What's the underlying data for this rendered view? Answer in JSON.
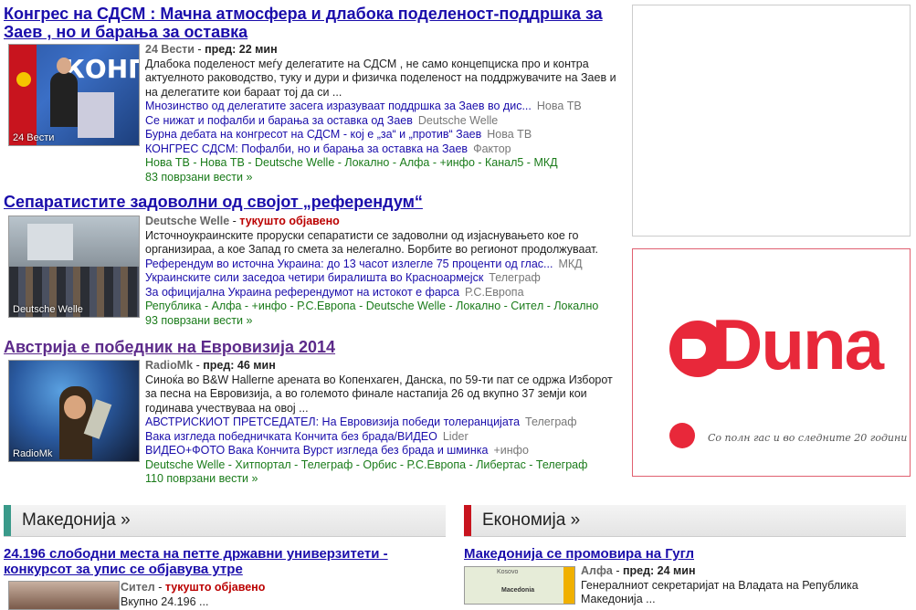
{
  "stories": [
    {
      "title": "Конгрес на СДСМ : Мачна атмосфера и длабока поделеност-поддршка за Заев , но и барања за оставка",
      "thumb_caption": "24 Вести",
      "source": "24 Вести",
      "time": "пред: 22 мин",
      "snippet": "Длабока поделеност меѓу делегатите на СДСМ , не само концепциска про и контра актуелното раководство, туку и дури и физичка поделеност на поддржувачите на Заев и на делегатите кои бараат тој да си ...",
      "related": [
        {
          "text": "Мнозинство од делегатите засега изразуваат поддршка за Заев во дис...",
          "source": "Нова ТВ"
        },
        {
          "text": "Се нижат и пофалби и барања за оставка од Заев",
          "source": "Deutsche Welle"
        },
        {
          "text": "Бурна дебата на конгресот на СДСМ - кој е „за“ и „против“ Заев",
          "source": "Нова ТВ"
        },
        {
          "text": "КОНГРЕС СДСМ: Пофалби, но и барања за оставка на Заев",
          "source": "Фактор"
        }
      ],
      "source_list": "Нова ТВ - Нова ТВ - Deutsche Welle - Локално - Алфа - +инфо - Канал5 - МКД",
      "more": "83 поврзани вести »"
    },
    {
      "title": "Сепаратистите задоволни од својот „референдум“",
      "thumb_caption": "Deutsche Welle",
      "source": "Deutsche Welle",
      "time": "тукушто објавено",
      "snippet": "Источноукраинските проруски сепаратисти се задоволни од изјаснувањето кое го организираа, а кое Запад го смета за нелегално. Борбите во регионот продолжуваат.",
      "related": [
        {
          "text": "Референдум во источна Украина: до 13 часот излегле 75 проценти од глас...",
          "source": "МКД"
        },
        {
          "text": "Украинските сили заседоа четири биралишта во Красноармејск",
          "source": "Телеграф"
        },
        {
          "text": "За официјална Украина референдумот на истокот е фарса",
          "source": "Р.С.Европа"
        }
      ],
      "source_list": "Република - Алфа - +инфо - Р.С.Европа - Deutsche Welle - Локално - Ситeл - Локално",
      "more": "93 поврзани вести »"
    },
    {
      "title": "Австрија е победник на Евровизија 2014",
      "thumb_caption": "RadioMk",
      "source": "RadioMk",
      "time": "пред: 46 мин",
      "snippet": "Синоќа во B&W Hallerne арената во Копенхаген, Данска, по 59-ти пат се одржа Изборот за песна на Евровизија, а во големото финале настапија 26 од вкупно 37 земји кои годинава учествуваа на овој ...",
      "related": [
        {
          "text": "АВСТРИСКИОТ ПРЕТСЕДАТЕЛ: На Евровизија победи толеранцијата",
          "source": "Телеграф"
        },
        {
          "text": "Вака изгледа победничката Кончита без брада/ВИДЕО",
          "source": "Lider"
        },
        {
          "text": "ВИДЕО+ФОТО Вака Кончита Вурст изгледа без брада и шминка",
          "source": "+инфо"
        }
      ],
      "source_list": "Deutsche Welle - Хитпортал - Телеграф - Орбис - Р.С.Европа - Либертас - Телеграф",
      "more": "110 поврзани вести »"
    }
  ],
  "ad": {
    "brand": "Duna",
    "tagline": "Со полн гас и во следните 20 години"
  },
  "sections": [
    {
      "label": "Македонија »",
      "color": "#3a9a8a",
      "story_title": "24.196 слободни места на петте државни универзитети - конкурсот за упис се објавува утре",
      "source": "Ситeл",
      "time": "тукушто објавено",
      "snippet": "Вкупно 24.196 ..."
    },
    {
      "label": "Економија »",
      "color": "#c8141e",
      "story_title": "Македонија се промовира на Гугл",
      "source": "Алфа",
      "time": "пред: 24 мин",
      "snippet": "Генералниот секретаријат на Владата на Република Македонија ...",
      "map_labels": [
        "Kosovo",
        "Macedonia"
      ]
    }
  ]
}
